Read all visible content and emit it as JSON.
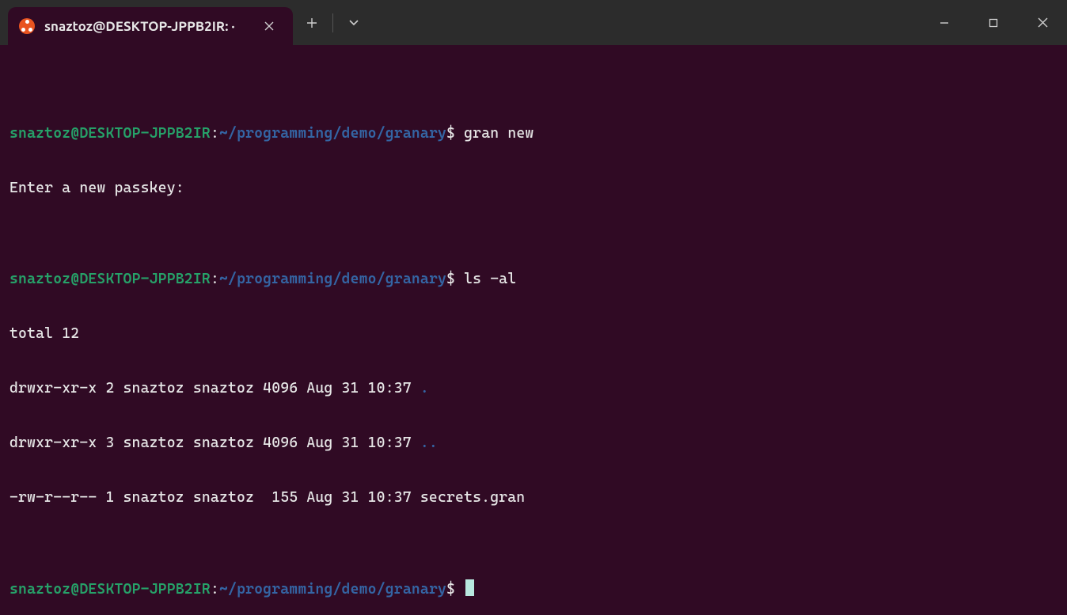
{
  "titlebar": {
    "tab_title": "snaztoz@DESKTOP-JPPB2IR: ·"
  },
  "prompt": {
    "user": "snaztoz",
    "at": "@",
    "host": "DESKTOP-JPPB2IR",
    "colon": ":",
    "path": "~/programming/demo/granary",
    "symbol": "$"
  },
  "session": {
    "entries": [
      {
        "command": "gran new",
        "output_lines": [
          {
            "text": "Enter a new passkey:"
          }
        ]
      },
      {
        "command": "ls -al",
        "output_lines": [
          {
            "text": "total 12"
          },
          {
            "text": "drwxr-xr-x 2 snaztoz snaztoz 4096 Aug 31 10:37 ",
            "trailing_dir": "."
          },
          {
            "text": "drwxr-xr-x 3 snaztoz snaztoz 4096 Aug 31 10:37 ",
            "trailing_dir": ".."
          },
          {
            "text": "-rw-r--r-- 1 snaztoz snaztoz  155 Aug 31 10:37 secrets.gran"
          }
        ]
      }
    ]
  },
  "colors": {
    "terminal_bg": "#300a24",
    "titlebar_bg": "#2c2c2c",
    "prompt_user": "#26a269",
    "prompt_path": "#3465a4",
    "text": "#e6e6e6",
    "cursor": "#b8e8df",
    "ubuntu_orange": "#e95420"
  }
}
